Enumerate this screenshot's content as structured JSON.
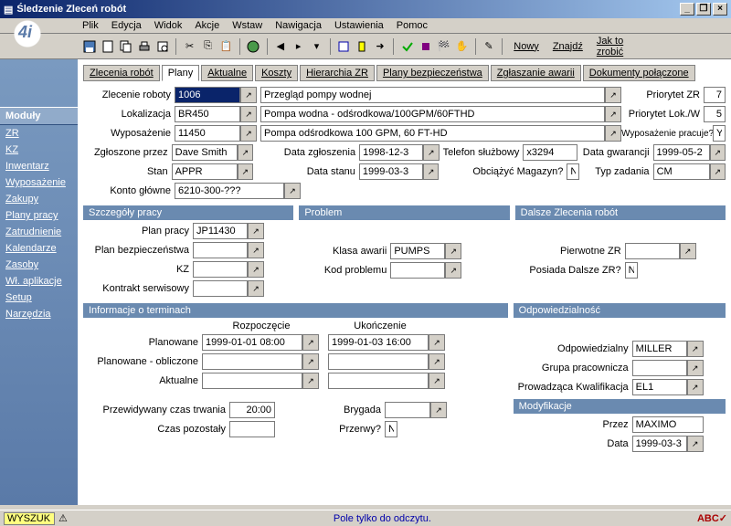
{
  "window": {
    "title": "Śledzenie Zleceń robót"
  },
  "menu": {
    "plik": "Plik",
    "edycja": "Edycja",
    "widok": "Widok",
    "akcje": "Akcje",
    "wstaw": "Wstaw",
    "nawigacja": "Nawigacja",
    "ustawienia": "Ustawienia",
    "pomoc": "Pomoc"
  },
  "toolbar_links": {
    "nowy": "Nowy",
    "znajdz": "Znajdź",
    "jak": "Jak to zrobić"
  },
  "sidebar": {
    "head": "Moduły",
    "items": [
      "ZR",
      "KZ",
      "Inwentarz",
      "Wyposażenie",
      "Zakupy",
      "Plany pracy",
      "Zatrudnienie",
      "Kalendarze",
      "Zasoby",
      "Wł. aplikacje",
      "Setup",
      "Narzędzia"
    ]
  },
  "tabs": [
    "Zlecenia robót",
    "Plany",
    "Aktualne",
    "Koszty",
    "Hierarchia ZR",
    "Plany bezpieczeństwa",
    "Zgłaszanie awarii",
    "Dokumenty połączone"
  ],
  "top": {
    "zlecenie_lbl": "Zlecenie roboty",
    "zlecenie": "1006",
    "zlecenie_desc": "Przegląd pompy wodnej",
    "lokalizacja_lbl": "Lokalizacja",
    "lokalizacja": "BR450",
    "lokalizacja_desc": "Pompa wodna - odśrodkowa/100GPM/60FTHD",
    "wyposazenie_lbl": "Wyposażenie",
    "wyposazenie": "11450",
    "wyposazenie_desc": "Pompa odśrodkowa 100 GPM, 60 FT-HD",
    "priorytet_zr_lbl": "Priorytet ZR",
    "priorytet_zr": "7",
    "priorytet_lok_lbl": "Priorytet Lok./W",
    "priorytet_lok": "5",
    "wyp_pracuje_lbl": "Wyposażenie pracuje?",
    "wyp_pracuje": "Y",
    "zgloszone_lbl": "Zgłoszone przez",
    "zgloszone": "Dave Smith",
    "data_zgl_lbl": "Data zgłoszenia",
    "data_zgl": "1998-12-3",
    "telefon_lbl": "Telefon służbowy",
    "telefon": "x3294",
    "data_gw_lbl": "Data gwarancji",
    "data_gw": "1999-05-2",
    "stan_lbl": "Stan",
    "stan": "APPR",
    "data_stanu_lbl": "Data stanu",
    "data_stanu": "1999-03-3",
    "obciazyc_lbl": "Obciążyć Magazyn?",
    "obciazyc": "N",
    "typ_zad_lbl": "Typ zadania",
    "typ_zad": "CM",
    "konto_lbl": "Konto główne",
    "konto": "6210-300-???"
  },
  "sections": {
    "szczegoly": "Szczegóły pracy",
    "problem": "Problem",
    "dalsze": "Dalsze Zlecenia robót",
    "terminy": "Informacje o terminach",
    "odpow": "Odpowiedzialność",
    "mody": "Modyfikacje"
  },
  "szcz": {
    "plan_lbl": "Plan pracy",
    "plan": "JP11430",
    "bezp_lbl": "Plan bezpieczeństwa",
    "bezp": "",
    "kz_lbl": "KZ",
    "kz": "",
    "kontrakt_lbl": "Kontrakt serwisowy",
    "kontrakt": ""
  },
  "prob": {
    "klasa_lbl": "Klasa awarii",
    "klasa": "PUMPS",
    "kod_lbl": "Kod problemu",
    "kod": ""
  },
  "dalsze": {
    "pierwotne_lbl": "Pierwotne ZR",
    "pierwotne": "",
    "posiada_lbl": "Posiada Dalsze ZR?",
    "posiada": "N"
  },
  "term": {
    "rozp": "Rozpoczęcie",
    "ukon": "Ukończenie",
    "planowane_lbl": "Planowane",
    "planowane_rozp": "1999-01-01 08:00",
    "planowane_ukon": "1999-01-03 16:00",
    "obliczone_lbl": "Planowane - obliczone",
    "obliczone_rozp": "",
    "obliczone_ukon": "",
    "aktualne_lbl": "Aktualne",
    "aktualne_rozp": "",
    "aktualne_ukon": "",
    "przew_lbl": "Przewidywany czas trwania",
    "przew": "20:00",
    "pozost_lbl": "Czas pozostały",
    "pozost": "",
    "brygada_lbl": "Brygada",
    "brygada": "",
    "przerwy_lbl": "Przerwy?",
    "przerwy": "N"
  },
  "odp": {
    "odp_lbl": "Odpowiedzialny",
    "odp": "MILLER",
    "grupa_lbl": "Grupa pracownicza",
    "grupa": "",
    "kwal_lbl": "Prowadząca Kwalifikacja",
    "kwal": "EL1"
  },
  "mod": {
    "przez_lbl": "Przez",
    "przez": "MAXIMO",
    "data_lbl": "Data",
    "data": "1999-03-3"
  },
  "statusbar": {
    "left": "WYSZUK",
    "center": "Pole tylko do odczytu."
  }
}
